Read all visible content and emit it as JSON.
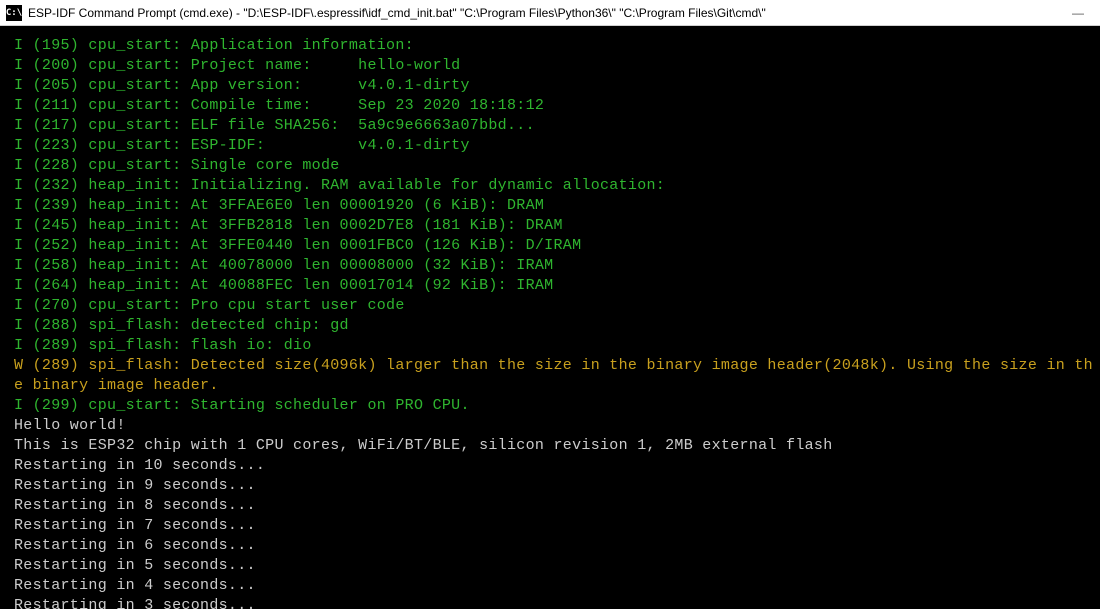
{
  "window": {
    "icon_label": "C:\\",
    "title": "ESP-IDF Command Prompt (cmd.exe) - \"D:\\ESP-IDF\\.espressif\\idf_cmd_init.bat\"  \"C:\\Program Files\\Python36\\\" \"C:\\Program Files\\Git\\cmd\\\""
  },
  "log": [
    {
      "level": "I",
      "ts": "195",
      "tag": "cpu_start",
      "msg": "Application information:"
    },
    {
      "level": "I",
      "ts": "200",
      "tag": "cpu_start",
      "msg": "Project name:     hello-world"
    },
    {
      "level": "I",
      "ts": "205",
      "tag": "cpu_start",
      "msg": "App version:      v4.0.1-dirty"
    },
    {
      "level": "I",
      "ts": "211",
      "tag": "cpu_start",
      "msg": "Compile time:     Sep 23 2020 18:18:12"
    },
    {
      "level": "I",
      "ts": "217",
      "tag": "cpu_start",
      "msg": "ELF file SHA256:  5a9c9e6663a07bbd..."
    },
    {
      "level": "I",
      "ts": "223",
      "tag": "cpu_start",
      "msg": "ESP-IDF:          v4.0.1-dirty"
    },
    {
      "level": "I",
      "ts": "228",
      "tag": "cpu_start",
      "msg": "Single core mode"
    },
    {
      "level": "I",
      "ts": "232",
      "tag": "heap_init",
      "msg": "Initializing. RAM available for dynamic allocation:"
    },
    {
      "level": "I",
      "ts": "239",
      "tag": "heap_init",
      "msg": "At 3FFAE6E0 len 00001920 (6 KiB): DRAM"
    },
    {
      "level": "I",
      "ts": "245",
      "tag": "heap_init",
      "msg": "At 3FFB2818 len 0002D7E8 (181 KiB): DRAM"
    },
    {
      "level": "I",
      "ts": "252",
      "tag": "heap_init",
      "msg": "At 3FFE0440 len 0001FBC0 (126 KiB): D/IRAM"
    },
    {
      "level": "I",
      "ts": "258",
      "tag": "heap_init",
      "msg": "At 40078000 len 00008000 (32 KiB): IRAM"
    },
    {
      "level": "I",
      "ts": "264",
      "tag": "heap_init",
      "msg": "At 40088FEC len 00017014 (92 KiB): IRAM"
    },
    {
      "level": "I",
      "ts": "270",
      "tag": "cpu_start",
      "msg": "Pro cpu start user code"
    },
    {
      "level": "I",
      "ts": "288",
      "tag": "spi_flash",
      "msg": "detected chip: gd"
    },
    {
      "level": "I",
      "ts": "289",
      "tag": "spi_flash",
      "msg": "flash io: dio"
    },
    {
      "level": "W",
      "ts": "289",
      "tag": "spi_flash",
      "msg": "Detected size(4096k) larger than the size in the binary image header(2048k). Using the size in the binary image header."
    },
    {
      "level": "I",
      "ts": "299",
      "tag": "cpu_start",
      "msg": "Starting scheduler on PRO CPU."
    }
  ],
  "plain": [
    "Hello world!",
    "This is ESP32 chip with 1 CPU cores, WiFi/BT/BLE, silicon revision 1, 2MB external flash",
    "Restarting in 10 seconds...",
    "Restarting in 9 seconds...",
    "Restarting in 8 seconds...",
    "Restarting in 7 seconds...",
    "Restarting in 6 seconds...",
    "Restarting in 5 seconds...",
    "Restarting in 4 seconds...",
    "Restarting in 3 seconds..."
  ]
}
